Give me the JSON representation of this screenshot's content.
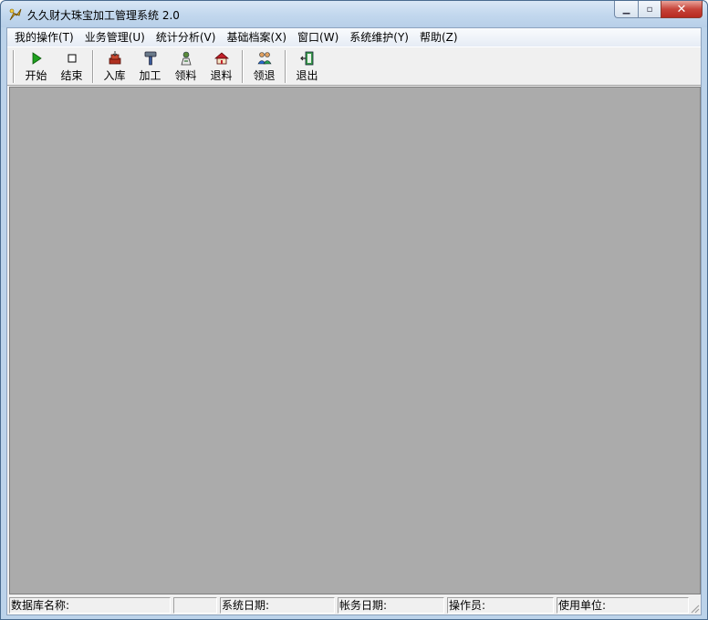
{
  "window": {
    "title": "久久财大珠宝加工管理系统 2.0",
    "controls": {
      "minimize": "▁",
      "maximize": "▫",
      "close": "✕"
    }
  },
  "menu": {
    "items": [
      "我的操作(T)",
      "业务管理(U)",
      "统计分析(V)",
      "基础档案(X)",
      "窗口(W)",
      "系统维护(Y)",
      "帮助(Z)"
    ]
  },
  "toolbar": {
    "groups": [
      [
        {
          "label": "开始",
          "icon": "play-icon"
        },
        {
          "label": "结束",
          "icon": "stop-icon"
        }
      ],
      [
        {
          "label": "入库",
          "icon": "stock-in-icon"
        },
        {
          "label": "加工",
          "icon": "hammer-icon"
        },
        {
          "label": "领料",
          "icon": "material-pickup-icon"
        },
        {
          "label": "退料",
          "icon": "material-return-icon"
        }
      ],
      [
        {
          "label": "领退",
          "icon": "users-icon"
        }
      ],
      [
        {
          "label": "退出",
          "icon": "exit-door-icon"
        }
      ]
    ]
  },
  "statusbar": {
    "panels": [
      "数据库名称:",
      "",
      "系统日期:",
      "帐务日期:",
      "操作员:",
      "使用单位:"
    ]
  },
  "colors": {
    "mdi_background": "#ababab",
    "play_green": "#1ea01e",
    "close_red": "#c7443a"
  }
}
